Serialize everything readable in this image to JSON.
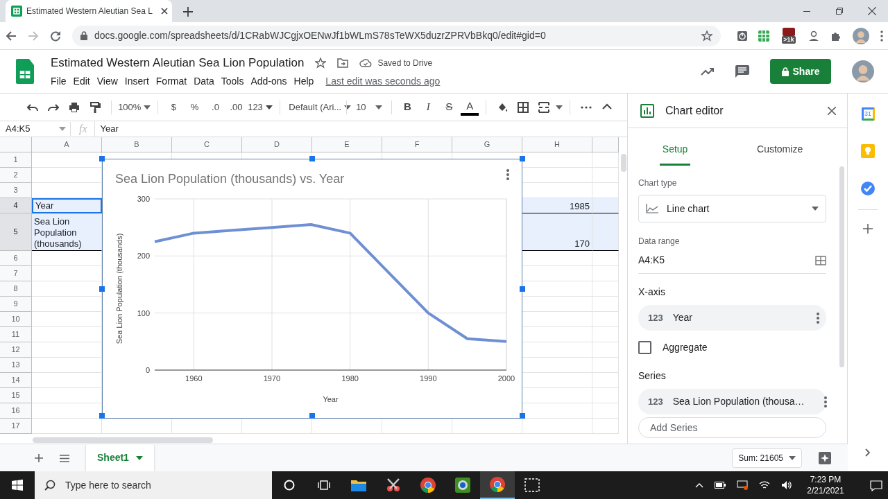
{
  "browser": {
    "tab_title": "Estimated Western Aleutian Sea L",
    "url": "docs.google.com/spreadsheets/d/1CRabWJCgjxOENwJf1bWLmS78sTeWX5duzrZPRVbBkq0/edit#gid=0",
    "extension_badge": ">1k"
  },
  "document": {
    "title": "Estimated Western Aleutian Sea Lion Population",
    "save_status": "Saved to Drive",
    "menu": [
      "File",
      "Edit",
      "View",
      "Insert",
      "Format",
      "Data",
      "Tools",
      "Add-ons",
      "Help"
    ],
    "last_edit": "Last edit was seconds ago",
    "share_button": "Share"
  },
  "toolbar": {
    "zoom": "100%",
    "currency": "$",
    "percent": "%",
    "decrease_decimal": ".0",
    "increase_decimal": ".00",
    "number_format": "123",
    "font": "Default (Ari...",
    "font_size": "10",
    "bold": "B",
    "italic": "I",
    "strikethrough": "S",
    "text_color": "A"
  },
  "formula_bar": {
    "name_box": "A4:K5",
    "fx": "fx",
    "content": "Year"
  },
  "sheet": {
    "columns": [
      "A",
      "B",
      "C",
      "D",
      "E",
      "F",
      "G",
      "H"
    ],
    "rows": [
      {
        "label": "1",
        "selected": false
      },
      {
        "label": "2",
        "selected": false
      },
      {
        "label": "3",
        "selected": false
      },
      {
        "label": "4",
        "selected": true,
        "cells": {
          "A": "Year",
          "H": "1985"
        }
      },
      {
        "label": "5",
        "selected": true,
        "cells": {
          "A": "Sea Lion Population (thousands)",
          "H": "170"
        }
      },
      {
        "label": "6",
        "selected": false
      },
      {
        "label": "7",
        "selected": false
      },
      {
        "label": "8",
        "selected": false
      },
      {
        "label": "9",
        "selected": false
      },
      {
        "label": "10",
        "selected": false
      },
      {
        "label": "11",
        "selected": false
      },
      {
        "label": "12",
        "selected": false
      },
      {
        "label": "13",
        "selected": false
      },
      {
        "label": "14",
        "selected": false
      },
      {
        "label": "15",
        "selected": false
      },
      {
        "label": "16",
        "selected": false
      },
      {
        "label": "17",
        "selected": false
      }
    ],
    "chart": {
      "chart_data": {
        "type": "line",
        "title": "Sea Lion Population (thousands) vs. Year",
        "xlabel": "Year",
        "ylabel": "Sea Lion Population (thousands)",
        "x": [
          1955,
          1960,
          1965,
          1970,
          1975,
          1980,
          1985,
          1990,
          1995,
          2000
        ],
        "series": [
          {
            "color": "#6f8fd4",
            "values": [
              225,
              240,
              245,
              250,
              255,
              240,
              170,
              100,
              55,
              50
            ]
          }
        ],
        "xlim": [
          1955,
          2000
        ],
        "ylim": [
          0,
          300
        ],
        "xticks": [
          1960,
          1970,
          1980,
          1990,
          2000
        ],
        "yticks": [
          0,
          100,
          200,
          300
        ],
        "grid": true
      }
    }
  },
  "chart_editor": {
    "title": "Chart editor",
    "tabs": [
      {
        "label": "Setup",
        "selected": true
      },
      {
        "label": "Customize",
        "selected": false
      }
    ],
    "chart_type_label": "Chart type",
    "chart_type": "Line chart",
    "data_range_label": "Data range",
    "data_range": "A4:K5",
    "x_axis_heading": "X-axis",
    "x_axis": {
      "type": "123",
      "label": "Year"
    },
    "aggregate": {
      "label": "Aggregate",
      "checked": false
    },
    "series_heading": "Series",
    "series": [
      {
        "type": "123",
        "label": "Sea Lion Population (thousa…"
      }
    ],
    "add_series": "Add Series"
  },
  "side_panel": {
    "calendar_day": "31"
  },
  "bottom_bar": {
    "sheets": [
      {
        "label": "Sheet1",
        "selected": true
      }
    ],
    "sum": "Sum: 21605"
  },
  "taskbar": {
    "search_placeholder": "Type here to search",
    "time": "7:23 PM",
    "date": "2/21/2021"
  }
}
